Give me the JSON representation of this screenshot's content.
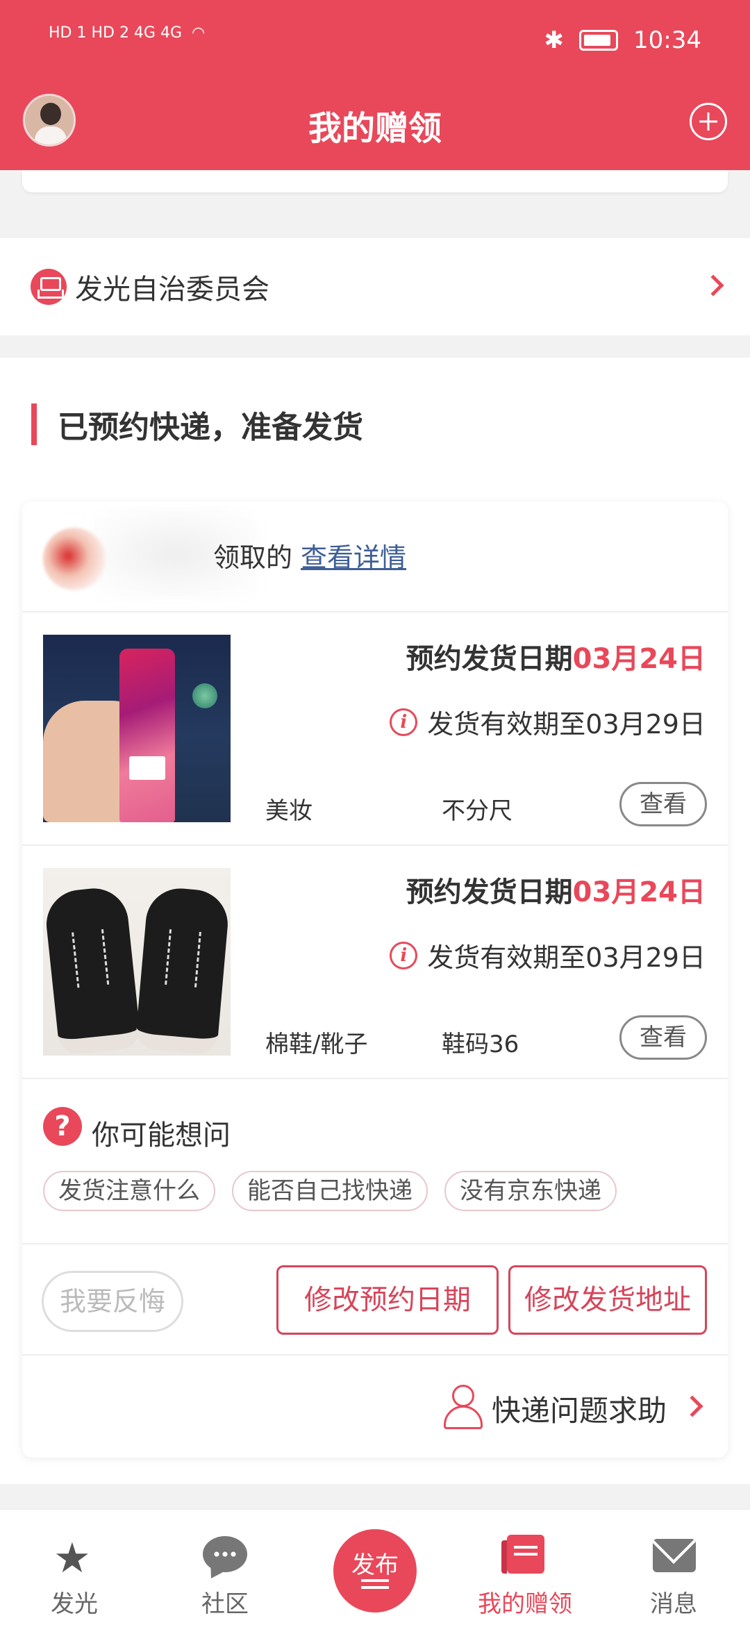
{
  "statusbar": {
    "network": "HD 1 HD 2 4G 4G",
    "time": "10:34"
  },
  "header": {
    "title": "我的赠领"
  },
  "committee": {
    "label": "发光自治委员会"
  },
  "section": {
    "title": "已预约快递，准备发货"
  },
  "card": {
    "claim_suffix": "领取的",
    "details_link": "查看详情",
    "items": [
      {
        "date_prefix": "预约发货日期",
        "date_value": "03月24日",
        "validity": "发货有效期至03月29日",
        "category": "美妆",
        "size": "不分尺",
        "view_label": "查看"
      },
      {
        "date_prefix": "预约发货日期",
        "date_value": "03月24日",
        "validity": "发货有效期至03月29日",
        "category": "棉鞋/靴子",
        "size": "鞋码36",
        "view_label": "查看"
      }
    ],
    "faq": {
      "title": "你可能想问",
      "chips": [
        "发货注意什么",
        "能否自己找快递",
        "没有京东快递"
      ]
    },
    "actions": {
      "regret": "我要反悔",
      "modify_date": "修改预约日期",
      "modify_address": "修改发货地址"
    },
    "help": {
      "label": "快递问题求助"
    }
  },
  "tabbar": {
    "items": [
      {
        "label": "发光",
        "icon": "star-icon"
      },
      {
        "label": "社区",
        "icon": "chat-bubble-icon"
      },
      {
        "label": "发布",
        "icon": "publish-icon"
      },
      {
        "label": "我的赠领",
        "icon": "gift-book-icon",
        "active": true
      },
      {
        "label": "消息",
        "icon": "mail-icon"
      }
    ]
  },
  "colors": {
    "brand": "#e8485a",
    "link": "#3e5e95"
  }
}
